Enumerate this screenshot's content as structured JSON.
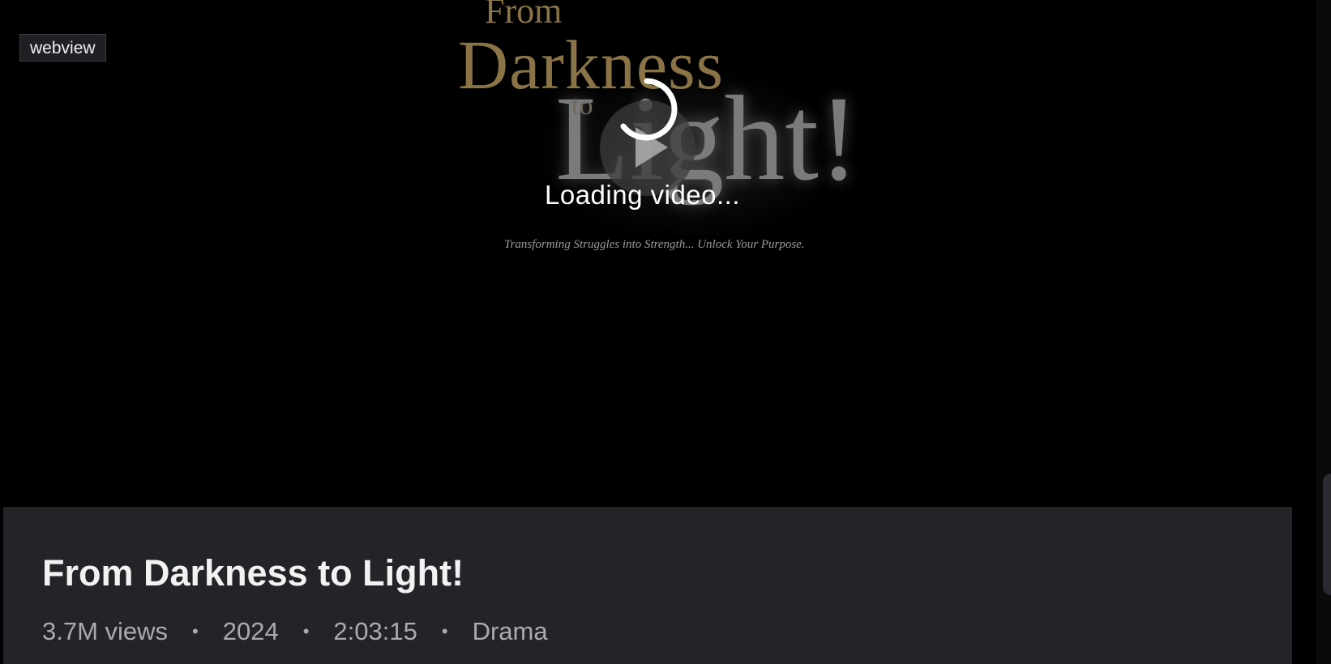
{
  "badge": {
    "label": "webview"
  },
  "poster": {
    "line1": "From",
    "line2": "Darkness",
    "line3": "to",
    "line4": "Light!",
    "tagline": "Transforming Struggles into Strength... Unlock Your Purpose."
  },
  "player": {
    "loading_text": "Loading video..."
  },
  "video": {
    "title": "From Darkness to Light!",
    "views": "3.7M views",
    "year": "2024",
    "duration": "2:03:15",
    "genre": "Drama",
    "separator": "•"
  },
  "colors": {
    "panel_bg": "#232428",
    "title": "#f2f2f2",
    "meta": "#a9abb0",
    "poster_gold": "#8a7446"
  },
  "icons": {
    "play": "play-icon",
    "spinner": "loading-spinner-icon"
  }
}
